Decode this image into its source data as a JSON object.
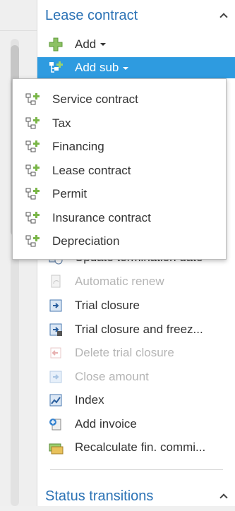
{
  "lease_section": {
    "title": "Lease contract"
  },
  "toolbar": {
    "add_label": "Add",
    "add_sub_label": "Add sub"
  },
  "add_sub_menu": {
    "items": [
      {
        "label": "Service contract",
        "icon": "hierarchy-add-icon"
      },
      {
        "label": "Tax",
        "icon": "hierarchy-add-icon"
      },
      {
        "label": "Financing",
        "icon": "hierarchy-add-icon"
      },
      {
        "label": "Lease contract",
        "icon": "hierarchy-add-icon"
      },
      {
        "label": "Permit",
        "icon": "hierarchy-add-icon"
      },
      {
        "label": "Insurance contract",
        "icon": "hierarchy-add-icon"
      },
      {
        "label": "Depreciation",
        "icon": "hierarchy-add-icon"
      }
    ]
  },
  "actions": {
    "items": [
      {
        "label": "Update termination date",
        "enabled": true,
        "icon": "calendar-clock-icon"
      },
      {
        "label": "Automatic renew",
        "enabled": false,
        "icon": "document-renew-icon"
      },
      {
        "label": "Trial closure",
        "enabled": true,
        "icon": "trial-closure-icon"
      },
      {
        "label": "Trial closure and freez...",
        "enabled": true,
        "icon": "trial-closure-freeze-icon"
      },
      {
        "label": "Delete trial closure",
        "enabled": false,
        "icon": "delete-trial-closure-icon"
      },
      {
        "label": "Close amount",
        "enabled": false,
        "icon": "close-amount-icon"
      },
      {
        "label": "Index",
        "enabled": true,
        "icon": "chart-index-icon"
      },
      {
        "label": "Add invoice",
        "enabled": true,
        "icon": "invoice-add-icon"
      },
      {
        "label": "Recalculate fin. commi...",
        "enabled": true,
        "icon": "recalculate-money-icon"
      }
    ]
  },
  "status_section": {
    "title": "Status transitions"
  },
  "colors": {
    "accent": "#2b72b5",
    "highlight": "#2e9be0",
    "disabled_text": "#b5b5b5",
    "icon_green": "#7ab648"
  }
}
